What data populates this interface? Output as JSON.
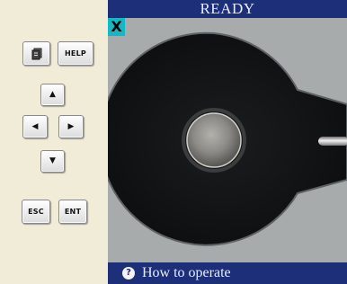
{
  "screen": {
    "status": "READY",
    "marker": "X",
    "help_text": "How to operate"
  },
  "controls": {
    "menu_icon": "document-icon",
    "help_label": "HELP",
    "up": "▲",
    "left": "◀",
    "right": "▶",
    "down": "▼",
    "esc_label": "ESC",
    "ent_label": "ENT"
  },
  "colors": {
    "panel_bg": "#f1ecd8",
    "title_bar": "#1c2f78",
    "marker": "#14b8c4",
    "screen_bg": "#101822"
  }
}
